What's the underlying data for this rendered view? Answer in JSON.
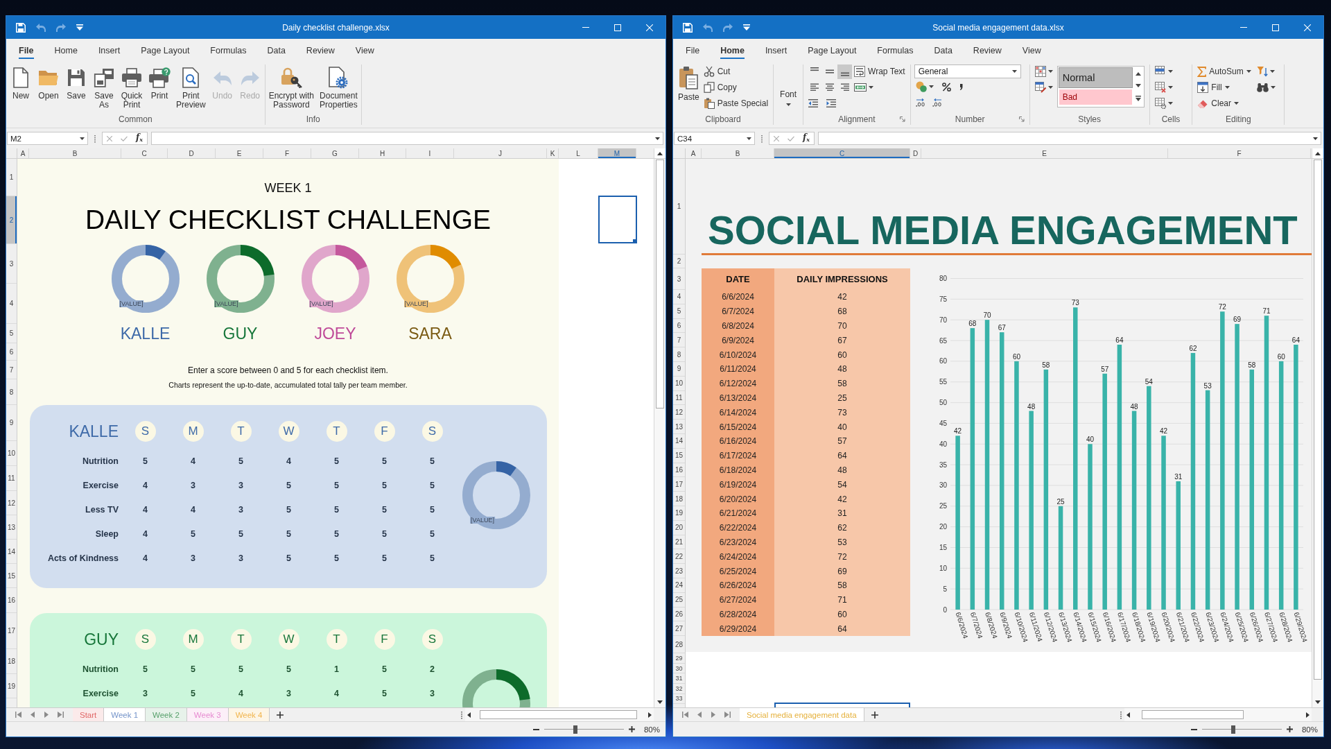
{
  "windows": [
    {
      "kind": "checklist",
      "title": "Daily checklist challenge.xlsx",
      "quick_access": [
        {
          "disabled": false
        },
        {
          "disabled": true
        },
        {
          "disabled": true
        },
        {
          "disabled": false
        }
      ],
      "menu_tabs": [
        {
          "label": "File",
          "selected": true
        },
        {
          "label": "Home",
          "selected": false
        },
        {
          "label": "Insert",
          "selected": false
        },
        {
          "label": "Page Layout",
          "selected": false
        },
        {
          "label": "Formulas",
          "selected": false
        },
        {
          "label": "Data",
          "selected": false
        },
        {
          "label": "Review",
          "selected": false
        },
        {
          "label": "View",
          "selected": false
        }
      ],
      "ribbon": {
        "groups": [
          {
            "label": "Common",
            "items": [
              {
                "label": "New",
                "disabled": false
              },
              {
                "label": "Open",
                "disabled": false
              },
              {
                "label": "Save",
                "disabled": false
              },
              {
                "label": "Save\nAs",
                "disabled": false
              },
              {
                "label": "Quick\nPrint",
                "disabled": false
              },
              {
                "label": "Print",
                "disabled": false
              },
              {
                "label": "Print\nPreview",
                "disabled": false
              },
              {
                "label": "Undo",
                "disabled": true
              },
              {
                "label": "Redo",
                "disabled": true
              }
            ]
          },
          {
            "label": "Info",
            "items": [
              {
                "label": "Encrypt with\nPassword",
                "disabled": false
              },
              {
                "label": "Document\nProperties",
                "disabled": false
              }
            ]
          }
        ]
      },
      "formula_bar": {
        "name_box": "M2",
        "function_button": "f$_{x}$"
      },
      "columns": [
        {
          "label": "A",
          "selected": false
        },
        {
          "label": "B",
          "selected": false
        },
        {
          "label": "C",
          "selected": false
        },
        {
          "label": "D",
          "selected": false
        },
        {
          "label": "E",
          "selected": false
        },
        {
          "label": "F",
          "selected": false
        },
        {
          "label": "G",
          "selected": false
        },
        {
          "label": "H",
          "selected": false
        },
        {
          "label": "I",
          "selected": false
        },
        {
          "label": "J",
          "selected": false
        },
        {
          "label": "K",
          "selected": false
        },
        {
          "label": "L",
          "selected": false
        },
        {
          "label": "M",
          "selected": true
        }
      ],
      "rows": [
        {
          "label": "1",
          "selected": false
        },
        {
          "label": "2",
          "selected": true
        },
        {
          "label": "3",
          "selected": false
        },
        {
          "label": "4",
          "selected": false
        },
        {
          "label": "5",
          "selected": false
        },
        {
          "label": "6",
          "selected": false
        },
        {
          "label": "7",
          "selected": false
        },
        {
          "label": "8",
          "selected": false
        },
        {
          "label": "9",
          "selected": false
        },
        {
          "label": "10",
          "selected": false
        },
        {
          "label": "11",
          "selected": false
        },
        {
          "label": "12",
          "selected": false
        },
        {
          "label": "13",
          "selected": false
        },
        {
          "label": "14",
          "selected": false
        },
        {
          "label": "15",
          "selected": false
        },
        {
          "label": "16",
          "selected": false
        },
        {
          "label": "17",
          "selected": false
        },
        {
          "label": "18",
          "selected": false
        },
        {
          "label": "19",
          "selected": false
        }
      ],
      "sheet": {
        "subtitle": "WEEK 1",
        "title": "DAILY CHECKLIST CHALLENGE",
        "team": [
          {
            "name": "KALLE",
            "color": "#3e6aa8",
            "donut": {
              "color": "#3563a5",
              "label": "[VALUE]"
            }
          },
          {
            "name": "GUY",
            "color": "#17763a",
            "donut": {
              "color": "#0d6b2b",
              "label": "[VALUE]"
            }
          },
          {
            "name": "JOEY",
            "color": "#bf4a99",
            "donut": {
              "color": "#c4589c",
              "label": "[VALUE]"
            }
          },
          {
            "name": "SARA",
            "color": "#7a5a12",
            "donut": {
              "color": "#e08c00",
              "label": "[VALUE]"
            }
          }
        ],
        "instructions": [
          "Enter a score between 0 and 5 for each checklist item.",
          "Charts represent the up-to-date, accumulated total tally per team member."
        ],
        "scorecards": [
          {
            "name": "KALLE",
            "color": "#3e6aa8",
            "days": [
              "S",
              "M",
              "T",
              "W",
              "T",
              "F",
              "S"
            ],
            "items": [
              {
                "label": "Nutrition",
                "scores": [
                  "5",
                  "4",
                  "5",
                  "4",
                  "5",
                  "5",
                  "5"
                ]
              },
              {
                "label": "Exercise",
                "scores": [
                  "4",
                  "3",
                  "3",
                  "5",
                  "5",
                  "5",
                  "5"
                ]
              },
              {
                "label": "Less TV",
                "scores": [
                  "4",
                  "4",
                  "3",
                  "5",
                  "5",
                  "5",
                  "5"
                ]
              },
              {
                "label": "Sleep",
                "scores": [
                  "4",
                  "5",
                  "5",
                  "5",
                  "5",
                  "5",
                  "5"
                ]
              },
              {
                "label": "Acts of Kindness",
                "scores": [
                  "4",
                  "3",
                  "3",
                  "5",
                  "5",
                  "5",
                  "5"
                ]
              }
            ],
            "donut": {
              "color": "#3563a5",
              "label": "[VALUE]"
            }
          },
          {
            "name": "GUY",
            "color": "#17763a",
            "days": [
              "S",
              "M",
              "T",
              "W",
              "T",
              "F",
              "S"
            ],
            "items": [
              {
                "label": "Nutrition",
                "scores": [
                  "5",
                  "5",
                  "5",
                  "5",
                  "1",
                  "5",
                  "2"
                ]
              },
              {
                "label": "Exercise",
                "scores": [
                  "3",
                  "5",
                  "4",
                  "3",
                  "4",
                  "5",
                  "3"
                ]
              }
            ],
            "donut": {
              "color": "#0d6b2b"
            }
          }
        ]
      },
      "sheet_tabs": [
        {
          "label": "Start",
          "selected": false,
          "color": "#e06666"
        },
        {
          "label": "Week 1",
          "selected": true,
          "color": "#7393c9"
        },
        {
          "label": "Week 2",
          "selected": false,
          "color": "#57a06b"
        },
        {
          "label": "Week 3",
          "selected": false,
          "color": "#e68ad0"
        },
        {
          "label": "Week 4",
          "selected": false,
          "color": "#f1b44c"
        }
      ],
      "zoom": {
        "level": 0.39,
        "reading": "80%"
      }
    },
    {
      "kind": "engagement",
      "title": "Social media engagement data.xlsx",
      "quick_access": [
        {
          "disabled": false
        },
        {
          "disabled": true
        },
        {
          "disabled": true
        },
        {
          "disabled": false
        }
      ],
      "menu_tabs": [
        {
          "label": "File",
          "selected": false
        },
        {
          "label": "Home",
          "selected": true
        },
        {
          "label": "Insert",
          "selected": false
        },
        {
          "label": "Page Layout",
          "selected": false
        },
        {
          "label": "Formulas",
          "selected": false
        },
        {
          "label": "Data",
          "selected": false
        },
        {
          "label": "Review",
          "selected": false
        },
        {
          "label": "View",
          "selected": false
        }
      ],
      "ribbon": {
        "groups": [
          {
            "label": "Clipboard",
            "items": [
              {
                "label": "Paste"
              },
              {
                "label": "Cut"
              },
              {
                "label": "Copy"
              },
              {
                "label": "Paste Special"
              }
            ]
          },
          {
            "items": [
              {
                "label": "Font"
              }
            ]
          },
          {
            "label": "Alignment",
            "items": [
              {
                "label": "Wrap Text"
              }
            ],
            "vertical_alignment": [
              {
                "selected": false
              },
              {
                "selected": false
              },
              {
                "selected": true
              }
            ],
            "horizontal_alignment": [
              {
                "selected": false
              },
              {
                "selected": false
              },
              {
                "selected": false
              }
            ]
          },
          {
            "label": "Number",
            "items": [
              {
                "value": "General"
              }
            ]
          },
          {
            "label": "Styles",
            "items": [
              {
                "label": "Normal",
                "kind": "neutral",
                "selected": true
              },
              {
                "label": "Bad",
                "kind": "bad",
                "selected": false
              }
            ]
          },
          {
            "label": "Cells"
          },
          {
            "label": "Editing",
            "items": [
              {
                "label": "AutoSum"
              },
              {
                "label": "Fill"
              },
              {
                "label": "Clear"
              }
            ]
          }
        ]
      },
      "formula_bar": {
        "name_box": "C34",
        "function_button": "f$_{x}$"
      },
      "columns": [
        {
          "label": "A",
          "selected": false
        },
        {
          "label": "B",
          "selected": false
        },
        {
          "label": "C",
          "selected": true
        },
        {
          "label": "D",
          "selected": false
        },
        {
          "label": "E",
          "selected": false
        },
        {
          "label": "F",
          "selected": false
        }
      ],
      "rows": [
        {
          "label": "1",
          "selected": false
        },
        {
          "label": "2",
          "selected": false
        },
        {
          "label": "3",
          "selected": false
        },
        {
          "label": "4",
          "selected": false
        },
        {
          "label": "5",
          "selected": false
        },
        {
          "label": "6",
          "selected": false
        },
        {
          "label": "7",
          "selected": false
        },
        {
          "label": "8",
          "selected": false
        },
        {
          "label": "9",
          "selected": false
        },
        {
          "label": "10",
          "selected": false
        },
        {
          "label": "11",
          "selected": false
        },
        {
          "label": "12",
          "selected": false
        },
        {
          "label": "13",
          "selected": false
        },
        {
          "label": "14",
          "selected": false
        },
        {
          "label": "15",
          "selected": false
        },
        {
          "label": "16",
          "selected": false
        },
        {
          "label": "17",
          "selected": false
        },
        {
          "label": "18",
          "selected": false
        },
        {
          "label": "19",
          "selected": false
        },
        {
          "label": "20",
          "selected": false
        },
        {
          "label": "21",
          "selected": false
        },
        {
          "label": "22",
          "selected": false
        },
        {
          "label": "23",
          "selected": false
        },
        {
          "label": "24",
          "selected": false
        },
        {
          "label": "25",
          "selected": false
        },
        {
          "label": "26",
          "selected": false
        },
        {
          "label": "27",
          "selected": false
        },
        {
          "label": "28",
          "selected": false
        },
        {
          "label": "29",
          "selected": false
        },
        {
          "label": "30",
          "selected": false
        },
        {
          "label": "31",
          "selected": false
        },
        {
          "label": "32",
          "selected": false
        },
        {
          "label": "33",
          "selected": false
        }
      ],
      "sheet": {
        "title": "SOCIAL MEDIA ENGAGEMENT",
        "table": {
          "columns": [
            "DATE",
            "DAILY IMPRESSIONS"
          ],
          "rows": [
            {
              "date": "6/6/2024",
              "impressions": "42"
            },
            {
              "date": "6/7/2024",
              "impressions": "68"
            },
            {
              "date": "6/8/2024",
              "impressions": "70"
            },
            {
              "date": "6/9/2024",
              "impressions": "67"
            },
            {
              "date": "6/10/2024",
              "impressions": "60"
            },
            {
              "date": "6/11/2024",
              "impressions": "48"
            },
            {
              "date": "6/12/2024",
              "impressions": "58"
            },
            {
              "date": "6/13/2024",
              "impressions": "25"
            },
            {
              "date": "6/14/2024",
              "impressions": "73"
            },
            {
              "date": "6/15/2024",
              "impressions": "40"
            },
            {
              "date": "6/16/2024",
              "impressions": "57"
            },
            {
              "date": "6/17/2024",
              "impressions": "64"
            },
            {
              "date": "6/18/2024",
              "impressions": "48"
            },
            {
              "date": "6/19/2024",
              "impressions": "54"
            },
            {
              "date": "6/20/2024",
              "impressions": "42"
            },
            {
              "date": "6/21/2024",
              "impressions": "31"
            },
            {
              "date": "6/22/2024",
              "impressions": "62"
            },
            {
              "date": "6/23/2024",
              "impressions": "53"
            },
            {
              "date": "6/24/2024",
              "impressions": "72"
            },
            {
              "date": "6/25/2024",
              "impressions": "69"
            },
            {
              "date": "6/26/2024",
              "impressions": "58"
            },
            {
              "date": "6/27/2024",
              "impressions": "71"
            },
            {
              "date": "6/28/2024",
              "impressions": "60"
            },
            {
              "date": "6/29/2024",
              "impressions": "64"
            }
          ]
        },
        "chart_data": {
          "type": "bar",
          "categories": [
            "6/6/2024",
            "6/7/2024",
            "6/8/2024",
            "6/9/2024",
            "6/10/2024",
            "6/11/2024",
            "6/12/2024",
            "6/13/2024",
            "6/14/2024",
            "6/15/2024",
            "6/16/2024",
            "6/17/2024",
            "6/18/2024",
            "6/19/2024",
            "6/20/2024",
            "6/21/2024",
            "6/22/2024",
            "6/23/2024",
            "6/24/2024",
            "6/25/2024",
            "6/26/2024",
            "6/27/2024",
            "6/28/2024",
            "6/29/2024"
          ],
          "series": [
            {
              "color": "#39b3a9",
              "values": [
                42,
                68,
                70,
                67,
                60,
                48,
                58,
                25,
                73,
                40,
                57,
                64,
                48,
                54,
                42,
                31,
                62,
                53,
                72,
                69,
                58,
                71,
                60,
                64
              ]
            }
          ],
          "ylim": [
            0,
            80
          ],
          "yticks": [
            0,
            5,
            10,
            15,
            20,
            25,
            30,
            35,
            40,
            45,
            50,
            55,
            60,
            65,
            70,
            75,
            80
          ],
          "grid": true,
          "data_labels": true
        }
      },
      "sheet_tabs": [
        {
          "label": "Social media engagement data",
          "selected": true,
          "color": "#e5b03a"
        }
      ],
      "zoom": {
        "level": 0.39,
        "reading": "80%"
      }
    }
  ]
}
